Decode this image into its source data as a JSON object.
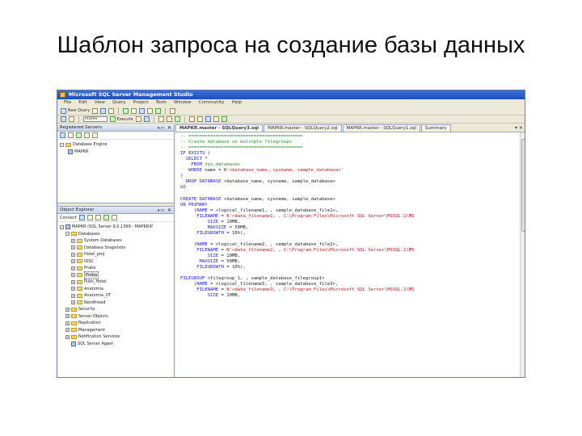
{
  "slide": {
    "title": "Шаблон запроса на создание базы данных"
  },
  "window": {
    "title": "Microsoft SQL Server Management Studio"
  },
  "menu": [
    "File",
    "Edit",
    "View",
    "Query",
    "Project",
    "Tools",
    "Window",
    "Community",
    "Help"
  ],
  "toolbar": {
    "new_query": "New Query",
    "database": "master",
    "execute": "Execute"
  },
  "registered_servers": {
    "title": "Registered Servers",
    "items": [
      {
        "label": "Database Engine"
      },
      {
        "label": "MAPKR"
      }
    ]
  },
  "object_explorer": {
    "title": "Object Explorer",
    "connect": "Connect",
    "server": "MAPKR (SQL Server 9.0.1399 - MAPKR\\P",
    "databases": "Databases",
    "items": [
      {
        "label": "System Databases"
      },
      {
        "label": "Database Snapshots"
      },
      {
        "label": "Hotel_proj"
      },
      {
        "label": "IDSC"
      },
      {
        "label": "Prabo"
      },
      {
        "label": "Proba"
      },
      {
        "label": "Pubs_Hotel"
      },
      {
        "label": "Anatomia"
      },
      {
        "label": "Anatomia_UT"
      },
      {
        "label": "Nordrhead"
      }
    ],
    "after": [
      {
        "label": "Security"
      },
      {
        "label": "Server Objects"
      },
      {
        "label": "Replication"
      },
      {
        "label": "Management"
      },
      {
        "label": "Notification Services"
      },
      {
        "label": "SQL Server Agent"
      }
    ]
  },
  "editor": {
    "tabs": [
      {
        "label": "MAPKR.master - SQLQuery3.sql"
      },
      {
        "label": "MAPKR.master - SQLQuery2.sql"
      },
      {
        "label": "MAPKR.master - SQLQuery1.sql"
      },
      {
        "label": "Summary"
      }
    ],
    "tab_controls": "▾ ✕"
  },
  "colors": {
    "titlebar": "#1f4fb5",
    "keyword": "#1a1aff",
    "string": "#c01818",
    "comment": "#2a8a2a",
    "function": "#c020c0"
  }
}
